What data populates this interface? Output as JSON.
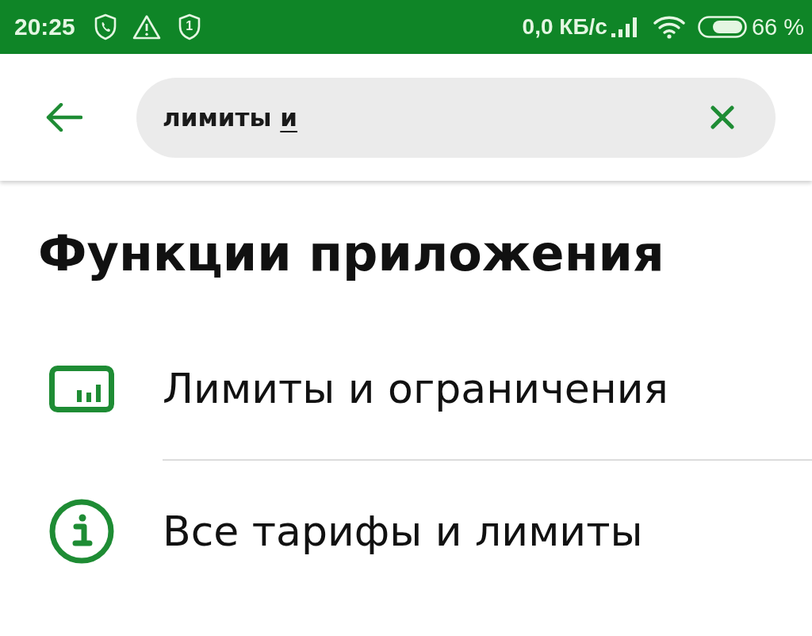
{
  "status_bar": {
    "time": "20:25",
    "shield_number": "1",
    "network_speed": "0,0 КБ/с",
    "battery": "66 %"
  },
  "search_bar": {
    "value": "лимиты",
    "composing_text": "и"
  },
  "section": {
    "title": "Функции приложения",
    "items": [
      {
        "kind": "limits",
        "label": "Лимиты и ограничения"
      },
      {
        "kind": "info",
        "label": "Все тарифы и лимиты"
      }
    ]
  }
}
